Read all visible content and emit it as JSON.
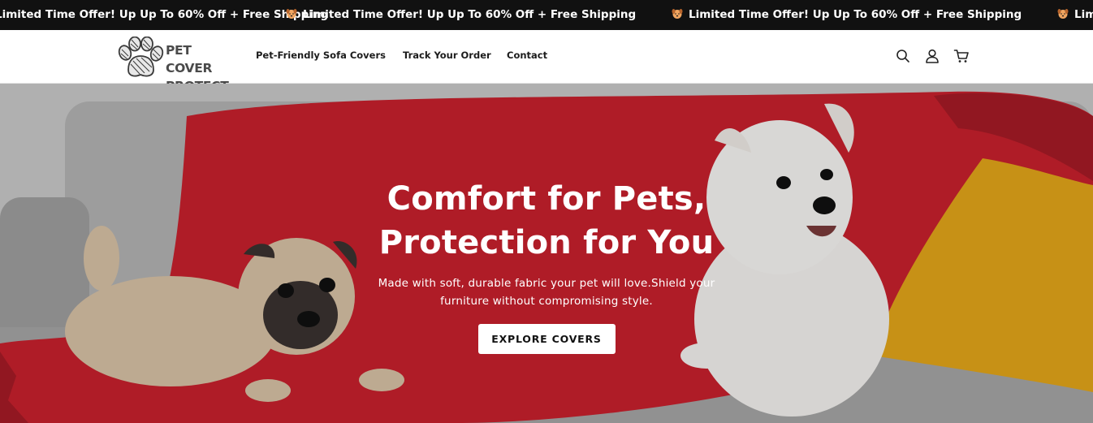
{
  "announcement": {
    "message": "Limited Time Offer! Up Up To 60% Off + Free Shipping",
    "emoji_icon": "dog-face-icon"
  },
  "header": {
    "logo": {
      "line1": "PET COVER",
      "line2": "PROTECT",
      "icon": "paw-icon"
    },
    "nav": [
      {
        "label": "Pet-Friendly Sofa Covers"
      },
      {
        "label": "Track Your Order"
      },
      {
        "label": "Contact"
      }
    ],
    "icons": [
      "search-icon",
      "account-icon",
      "cart-icon"
    ]
  },
  "hero": {
    "title_line1": "Comfort for Pets,",
    "title_line2": "Protection for You",
    "subtitle": "Made with soft, durable fabric your pet will love.Shield your furniture without compromising style.",
    "cta_label": "EXPLORE COVERS"
  },
  "colors": {
    "announcement_bg": "#111111",
    "throw_red": "#c8202d",
    "sofa_gray": "#a8a8a8",
    "pillow_yellow": "#e3a61a"
  }
}
